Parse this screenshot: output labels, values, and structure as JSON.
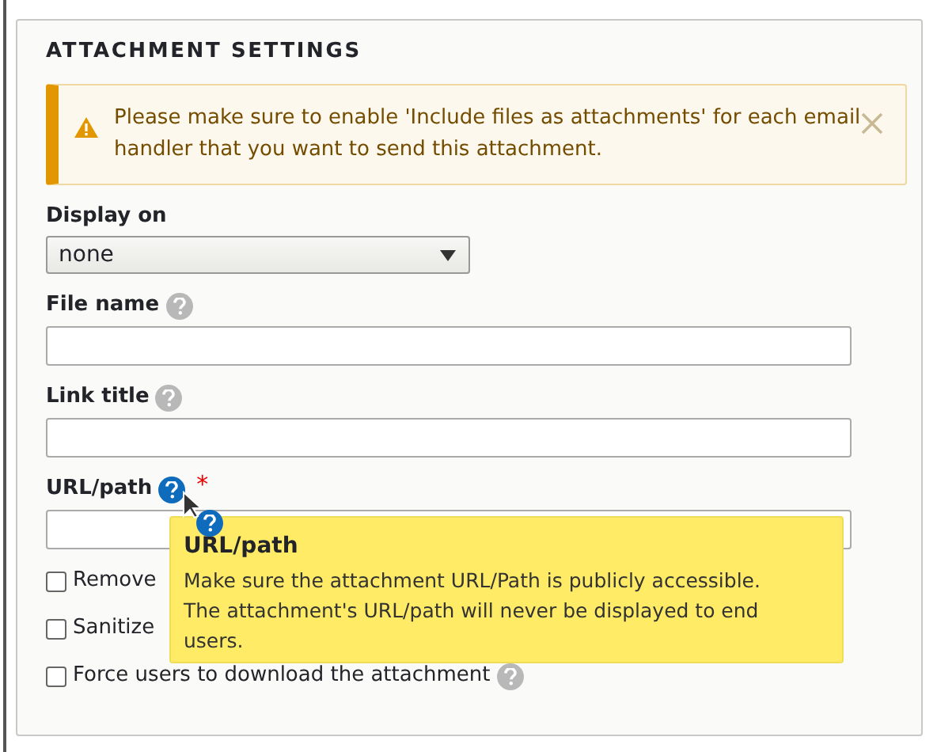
{
  "section": {
    "title": "ATTACHMENT SETTINGS"
  },
  "alert": {
    "message": "Please make sure to enable 'Include files as attachments' for each email handler that you want to send this attachment.",
    "dismissible": true
  },
  "fields": [
    {
      "kind": "select",
      "label": "Display on",
      "value": "none",
      "help": false,
      "required": false
    },
    {
      "kind": "text",
      "label": "File name",
      "help": true,
      "help_active": false,
      "required": false
    },
    {
      "kind": "text",
      "label": "Link title",
      "help": true,
      "help_active": false,
      "required": false
    },
    {
      "kind": "text",
      "label": "URL/path",
      "help": true,
      "help_active": true,
      "required": true,
      "required_mark": "*"
    }
  ],
  "checkboxes": [
    {
      "label": "Remove",
      "checked": false,
      "help": false
    },
    {
      "label": "Sanitize",
      "checked": false,
      "help": false
    },
    {
      "label": "Force users to download the attachment",
      "checked": false,
      "help": true
    }
  ],
  "tooltip": {
    "title": "URL/path",
    "body": "Make sure the attachment URL/Path is publicly accessible. The attachment's URL/path will never be displayed to end users."
  }
}
